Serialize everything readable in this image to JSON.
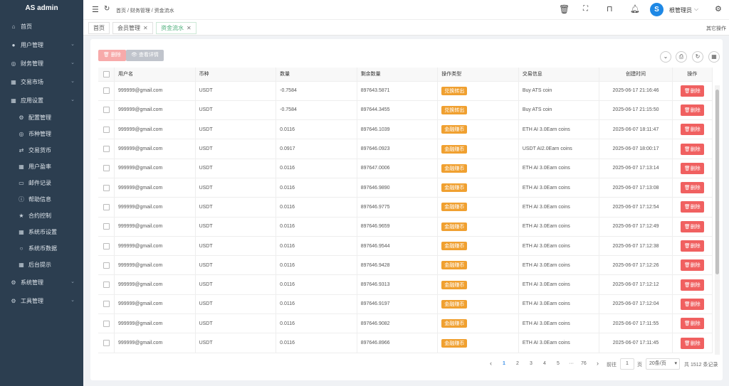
{
  "app": {
    "title": "AS admin"
  },
  "sidebar": {
    "items": [
      {
        "label": "首页",
        "icon": "home-icon",
        "glyph": "⌂",
        "expandable": false
      },
      {
        "label": "用户管理",
        "icon": "user-icon",
        "glyph": "●",
        "expandable": true
      },
      {
        "label": "财务管理",
        "icon": "database-icon",
        "glyph": "◎",
        "expandable": true
      },
      {
        "label": "交易市场",
        "icon": "grid-icon",
        "glyph": "▦",
        "expandable": true
      },
      {
        "label": "应用设置",
        "icon": "grid-icon",
        "glyph": "▦",
        "expandable": true,
        "expanded": true
      }
    ],
    "subitems": [
      {
        "label": "配置管理",
        "icon": "settings-icon",
        "glyph": "⚙"
      },
      {
        "label": "币种管理",
        "icon": "database-icon",
        "glyph": "◎"
      },
      {
        "label": "交易货币",
        "icon": "exchange-icon",
        "glyph": "⇄"
      },
      {
        "label": "用户盈率",
        "icon": "grid-icon",
        "glyph": "▦"
      },
      {
        "label": "邮件记录",
        "icon": "folder-icon",
        "glyph": "▭"
      },
      {
        "label": "帮助信息",
        "icon": "info-icon",
        "glyph": "ⓘ"
      },
      {
        "label": "合约控制",
        "icon": "star-icon",
        "glyph": "★"
      },
      {
        "label": "系统币设置",
        "icon": "grid-icon",
        "glyph": "▦"
      },
      {
        "label": "系统币数据",
        "icon": "circle-icon",
        "glyph": "○"
      },
      {
        "label": "后台提示",
        "icon": "grid-icon",
        "glyph": "▦"
      }
    ],
    "bottom_items": [
      {
        "label": "系统管理",
        "icon": "gear-icon",
        "glyph": "⚙",
        "expandable": true
      },
      {
        "label": "工具管理",
        "icon": "gear-icon",
        "glyph": "⚙",
        "expandable": true
      }
    ]
  },
  "topbar": {
    "breadcrumb": "首页 / 财务管理 / 资金流水",
    "user_name": "根管理员",
    "avatar_letter": "S"
  },
  "tabs": {
    "items": [
      {
        "label": "首页",
        "closable": false,
        "active": false
      },
      {
        "label": "会员管理",
        "closable": true,
        "active": false
      },
      {
        "label": "资金流水",
        "closable": true,
        "active": true
      }
    ],
    "close_glyph": "✕",
    "other_ops": "其它操作"
  },
  "toolbar": {
    "delete_label": "删除",
    "view_label": "查看详情"
  },
  "table": {
    "headers": [
      "用户名",
      "币种",
      "数量",
      "剩余数量",
      "操作类型",
      "交易信息",
      "创建时间",
      "操作"
    ],
    "delete_label": "删除",
    "rows": [
      {
        "user": "999999@gmail.com",
        "coin": "USDT",
        "qty": "-0.7584",
        "remain": "897643.5871",
        "type": "兑换转出",
        "info": "Buy ATS coin",
        "time": "2025-06-17 21:16:46"
      },
      {
        "user": "999999@gmail.com",
        "coin": "USDT",
        "qty": "-0.7584",
        "remain": "897644.3455",
        "type": "兑换转出",
        "info": "Buy ATS coin",
        "time": "2025-06-17 21:15:50"
      },
      {
        "user": "999999@gmail.com",
        "coin": "USDT",
        "qty": "0.0116",
        "remain": "897646.1039",
        "type": "金融赚币",
        "info": "ETH AI 3.0Earn coins",
        "time": "2025-06-07 18:11:47"
      },
      {
        "user": "999999@gmail.com",
        "coin": "USDT",
        "qty": "0.0917",
        "remain": "897646.0923",
        "type": "金融赚币",
        "info": "USDT AI2.0Earn coins",
        "time": "2025-06-07 18:00:17"
      },
      {
        "user": "999999@gmail.com",
        "coin": "USDT",
        "qty": "0.0116",
        "remain": "897647.0006",
        "type": "金融赚币",
        "info": "ETH AI 3.0Earn coins",
        "time": "2025-06-07 17:13:14"
      },
      {
        "user": "999999@gmail.com",
        "coin": "USDT",
        "qty": "0.0116",
        "remain": "897646.9890",
        "type": "金融赚币",
        "info": "ETH AI 3.0Earn coins",
        "time": "2025-06-07 17:13:08"
      },
      {
        "user": "999999@gmail.com",
        "coin": "USDT",
        "qty": "0.0116",
        "remain": "897646.9775",
        "type": "金融赚币",
        "info": "ETH AI 3.0Earn coins",
        "time": "2025-06-07 17:12:54"
      },
      {
        "user": "999999@gmail.com",
        "coin": "USDT",
        "qty": "0.0116",
        "remain": "897646.9659",
        "type": "金融赚币",
        "info": "ETH AI 3.0Earn coins",
        "time": "2025-06-07 17:12:49"
      },
      {
        "user": "999999@gmail.com",
        "coin": "USDT",
        "qty": "0.0116",
        "remain": "897646.9544",
        "type": "金融赚币",
        "info": "ETH AI 3.0Earn coins",
        "time": "2025-06-07 17:12:38"
      },
      {
        "user": "999999@gmail.com",
        "coin": "USDT",
        "qty": "0.0116",
        "remain": "897646.9428",
        "type": "金融赚币",
        "info": "ETH AI 3.0Earn coins",
        "time": "2025-06-07 17:12:26"
      },
      {
        "user": "999999@gmail.com",
        "coin": "USDT",
        "qty": "0.0116",
        "remain": "897646.9313",
        "type": "金融赚币",
        "info": "ETH AI 3.0Earn coins",
        "time": "2025-06-07 17:12:12"
      },
      {
        "user": "999999@gmail.com",
        "coin": "USDT",
        "qty": "0.0116",
        "remain": "897646.9197",
        "type": "金融赚币",
        "info": "ETH AI 3.0Earn coins",
        "time": "2025-06-07 17:12:04"
      },
      {
        "user": "999999@gmail.com",
        "coin": "USDT",
        "qty": "0.0116",
        "remain": "897646.9082",
        "type": "金融赚币",
        "info": "ETH AI 3.0Earn coins",
        "time": "2025-06-07 17:11:55"
      },
      {
        "user": "999999@gmail.com",
        "coin": "USDT",
        "qty": "0.0116",
        "remain": "897646.8966",
        "type": "金融赚币",
        "info": "ETH AI 3.0Earn coins",
        "time": "2025-06-07 17:11:45"
      }
    ]
  },
  "pagination": {
    "pages": [
      "1",
      "2",
      "3",
      "4",
      "5",
      "···",
      "76"
    ],
    "goto_label": "前往",
    "goto_value": "1",
    "page_unit": "页",
    "page_size": "20条/页",
    "total": "共 1512 条记录"
  }
}
